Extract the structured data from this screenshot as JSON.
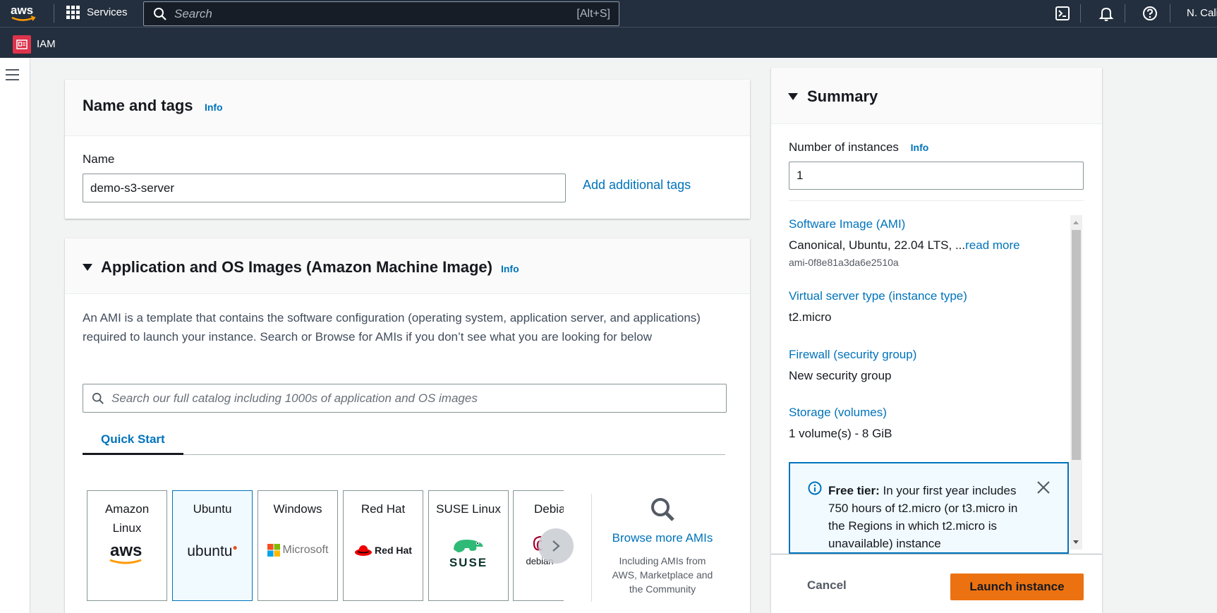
{
  "topnav": {
    "services_label": "Services",
    "search_placeholder": "Search",
    "search_shortcut": "[Alt+S]",
    "region_label": "N. Cali"
  },
  "subnav": {
    "service_label": "IAM"
  },
  "name_tags": {
    "title": "Name and tags",
    "info": "Info",
    "name_label": "Name",
    "name_value": "demo-s3-server",
    "add_tags_link": "Add additional tags"
  },
  "ami": {
    "title": "Application and OS Images (Amazon Machine Image)",
    "info": "Info",
    "description": "An AMI is a template that contains the software configuration (operating system, application server, and applications) required to launch your instance. Search or Browse for AMIs if you don’t see what you are looking for below",
    "search_placeholder": "Search our full catalog including 1000s of application and OS images",
    "tab_quick_start": "Quick Start",
    "tiles": [
      {
        "name_line1": "Amazon",
        "name_line2": "Linux",
        "logo": "aws"
      },
      {
        "name_line1": "Ubuntu",
        "name_line2": "",
        "logo": "ubuntu"
      },
      {
        "name_line1": "Windows",
        "name_line2": "",
        "logo": "Microsoft"
      },
      {
        "name_line1": "Red Hat",
        "name_line2": "",
        "logo": "Red Hat"
      },
      {
        "name_line1": "SUSE Linux",
        "name_line2": "",
        "logo": "SUSE"
      },
      {
        "name_line1": "Debia",
        "name_line2": "",
        "logo": "debian"
      }
    ],
    "browse_link": "Browse more AMIs",
    "browse_sub": "Including AMIs from AWS, Marketplace and the Community"
  },
  "summary": {
    "title": "Summary",
    "num_instances_label": "Number of instances",
    "info": "Info",
    "num_instances_value": "1",
    "software_image_label": "Software Image (AMI)",
    "software_image_value": "Canonical, Ubuntu, 22.04 LTS, ...",
    "read_more": "read more",
    "ami_id": "ami-0f8e81a3da6e2510a",
    "instance_type_label": "Virtual server type (instance type)",
    "instance_type_value": "t2.micro",
    "firewall_label": "Firewall (security group)",
    "firewall_value": "New security group",
    "storage_label": "Storage (volumes)",
    "storage_value": "1 volume(s) - 8 GiB",
    "free_tier_bold": "Free tier:",
    "free_tier_text": " In your first year includes 750 hours of t2.micro (or t3.micro in the Regions in which t2.micro is unavailable) instance",
    "cancel": "Cancel",
    "launch": "Launch instance"
  },
  "colors": {
    "nav_bg": "#232f3e",
    "link": "#0073bb",
    "primary_button": "#ec7211",
    "iam_badge": "#dd344c"
  }
}
